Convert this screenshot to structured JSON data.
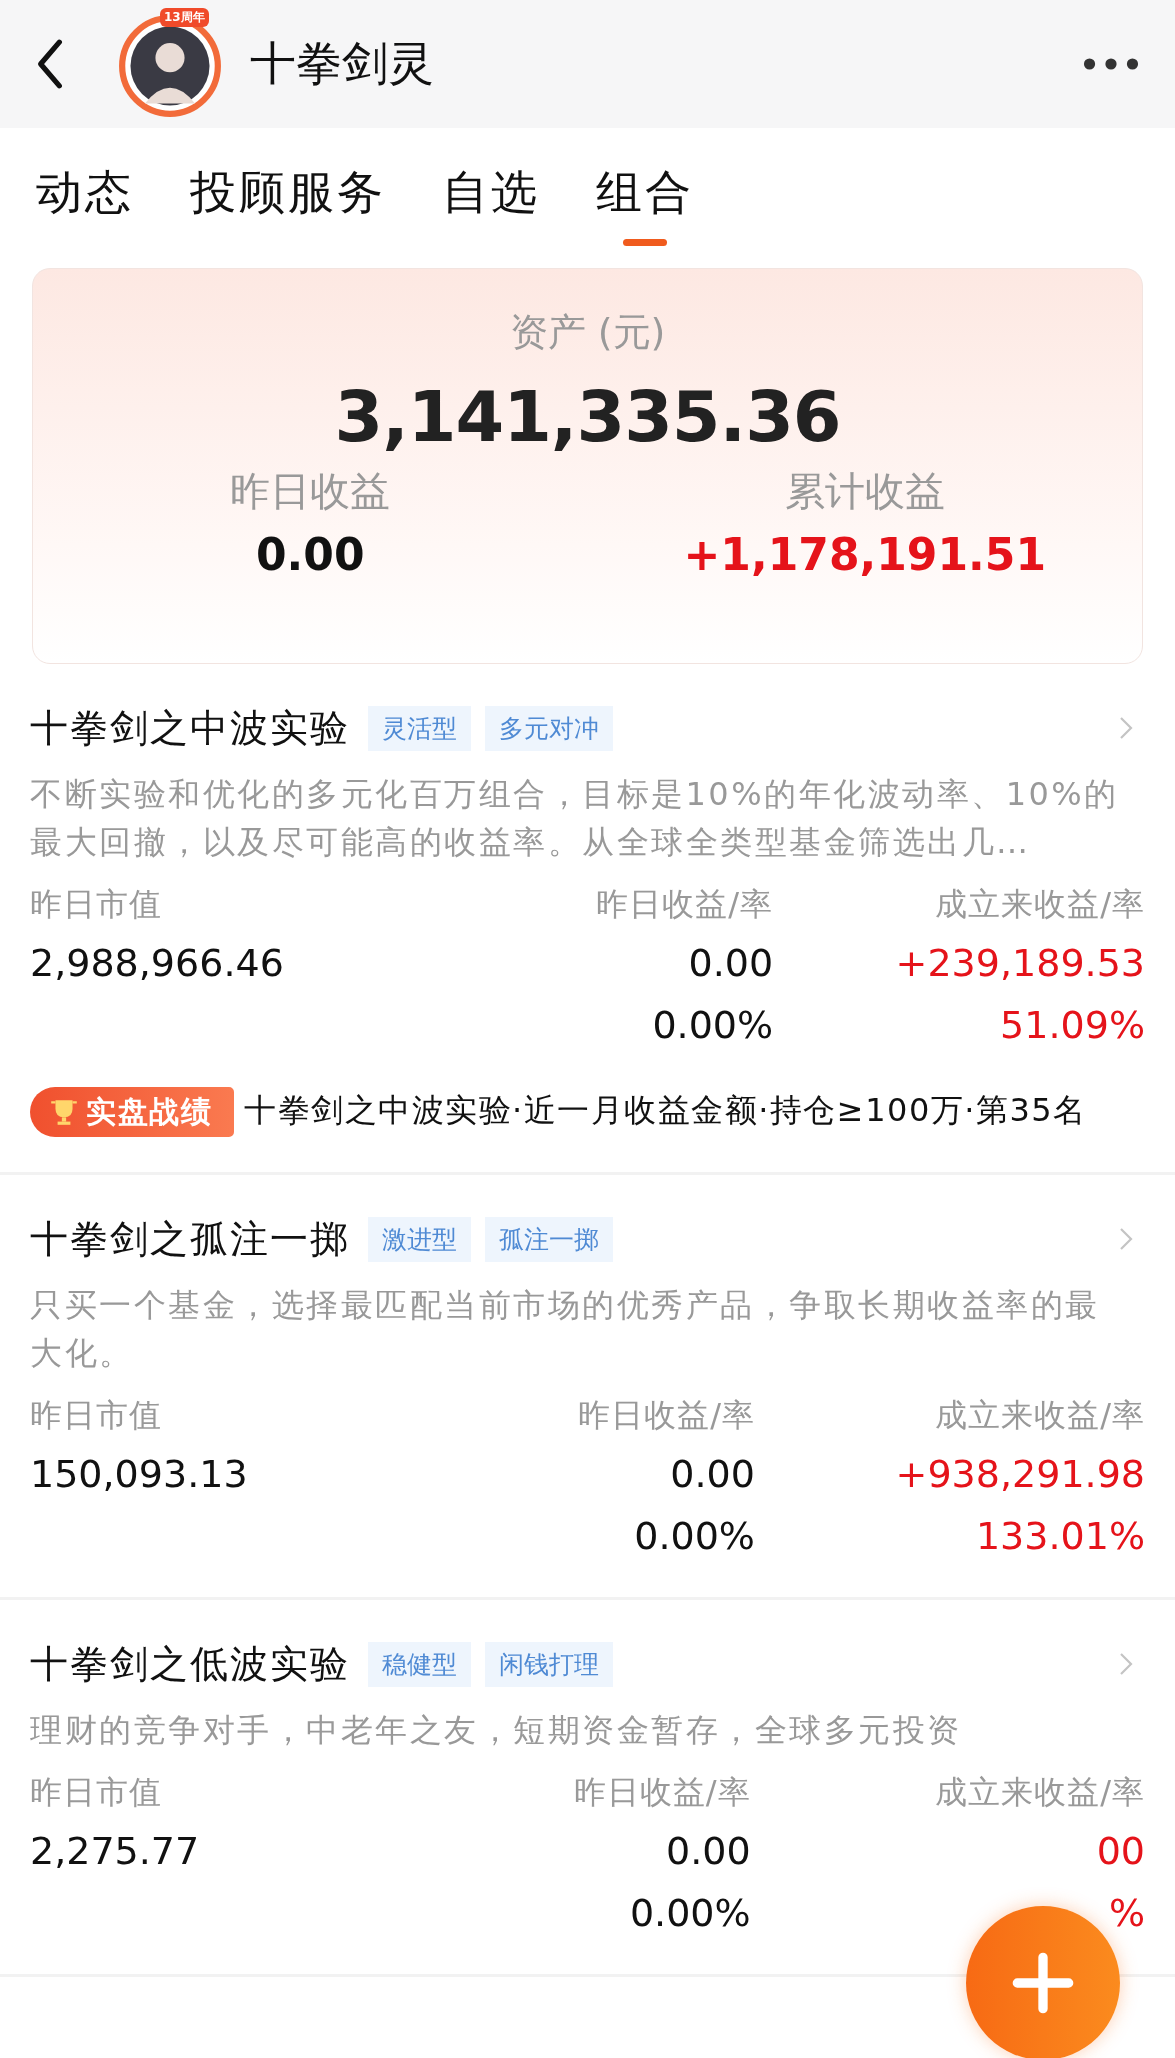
{
  "header": {
    "title": "十拳剑灵",
    "avatar_badge": "13周年"
  },
  "tabs": [
    {
      "label": "动态",
      "selected": false
    },
    {
      "label": "投顾服务",
      "selected": false
    },
    {
      "label": "自选",
      "selected": false
    },
    {
      "label": "组合",
      "selected": true
    }
  ],
  "assets": {
    "label": "资产 (元)",
    "value": "3,141,335.36",
    "stats": [
      {
        "label": "昨日收益",
        "value": "0.00",
        "positive": false
      },
      {
        "label": "累计收益",
        "value": "+1,178,191.51",
        "positive": true
      }
    ]
  },
  "portfolios": [
    {
      "name": "十拳剑之中波实验",
      "tags": [
        "灵活型",
        "多元对冲"
      ],
      "description": "不断实验和优化的多元化百万组合，目标是10%的年化波动率、10%的最大回撤，以及尽可能高的收益率。从全球全类型基金筛选出几…",
      "columns": [
        {
          "label": "昨日市值",
          "values": [
            "2,988,966.46"
          ],
          "positive": false
        },
        {
          "label": "昨日收益/率",
          "values": [
            "0.00",
            "0.00%"
          ],
          "positive": false
        },
        {
          "label": "成立来收益/率",
          "values": [
            "+239,189.53",
            "51.09%"
          ],
          "positive": true
        }
      ],
      "award": {
        "badge": "实盘战绩",
        "text": "十拳剑之中波实验·近一月收益金额·持仓≥100万·第35名"
      }
    },
    {
      "name": "十拳剑之孤注一掷",
      "tags": [
        "激进型",
        "孤注一掷"
      ],
      "description": "只买一个基金，选择最匹配当前市场的优秀产品，争取长期收益率的最大化。",
      "columns": [
        {
          "label": "昨日市值",
          "values": [
            "150,093.13"
          ],
          "positive": false
        },
        {
          "label": "昨日收益/率",
          "values": [
            "0.00",
            "0.00%"
          ],
          "positive": false
        },
        {
          "label": "成立来收益/率",
          "values": [
            "+938,291.98",
            "133.01%"
          ],
          "positive": true
        }
      ]
    },
    {
      "name": "十拳剑之低波实验",
      "tags": [
        "稳健型",
        "闲钱打理"
      ],
      "description": "理财的竞争对手，中老年之友，短期资金暂存，全球多元投资",
      "columns": [
        {
          "label": "昨日市值",
          "values": [
            "2,275.77"
          ],
          "positive": false
        },
        {
          "label": "昨日收益/率",
          "values": [
            "0.00",
            "0.00%"
          ],
          "positive": false
        },
        {
          "label": "成立来收益/率",
          "values": [
            "00",
            "%"
          ],
          "positive": true
        }
      ]
    }
  ]
}
